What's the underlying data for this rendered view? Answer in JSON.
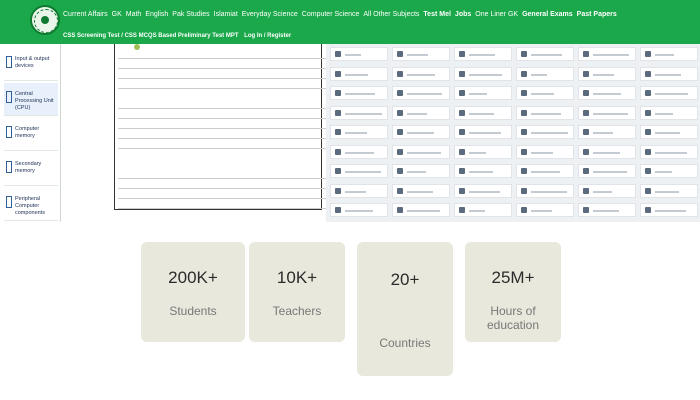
{
  "header": {
    "logo_icon": "site-logo-emblem",
    "nav_items": [
      {
        "label": "Current Affairs",
        "bold": false
      },
      {
        "label": "GK",
        "bold": false
      },
      {
        "label": "Math",
        "bold": false
      },
      {
        "label": "English",
        "bold": false
      },
      {
        "label": "Pak Studies",
        "bold": false
      },
      {
        "label": "Islamiat",
        "bold": false
      },
      {
        "label": "Everyday Science",
        "bold": false
      },
      {
        "label": "Computer Science",
        "bold": false
      },
      {
        "label": "All Other Subjects",
        "bold": false
      },
      {
        "label": "Test Mel",
        "bold": true
      },
      {
        "label": "Jobs",
        "bold": true
      },
      {
        "label": "One Liner GK",
        "bold": false
      },
      {
        "label": "General Exams",
        "bold": true
      },
      {
        "label": "Past Papers",
        "bold": true
      }
    ],
    "nav_row2": "CSS Screening Test / CSS MCQS Based Preliminary Test MPT",
    "login_link": "Log In / Register",
    "colors": {
      "bar": "#1aa84a",
      "text": "#ffffff"
    }
  },
  "left_list": [
    {
      "label": "Input & output devices",
      "active": false
    },
    {
      "label": "Central Processing Unit (CPU)",
      "active": true
    },
    {
      "label": "Computer memory",
      "active": false
    },
    {
      "label": "Secondary memory",
      "active": false
    },
    {
      "label": "Peripheral Computer components",
      "active": false
    }
  ],
  "stats": [
    {
      "value": "200K+",
      "label": "Students"
    },
    {
      "value": "10K+",
      "label": "Teachers"
    },
    {
      "value": "20+",
      "label": "Countries"
    },
    {
      "value": "25M+",
      "label": "Hours of education"
    }
  ]
}
